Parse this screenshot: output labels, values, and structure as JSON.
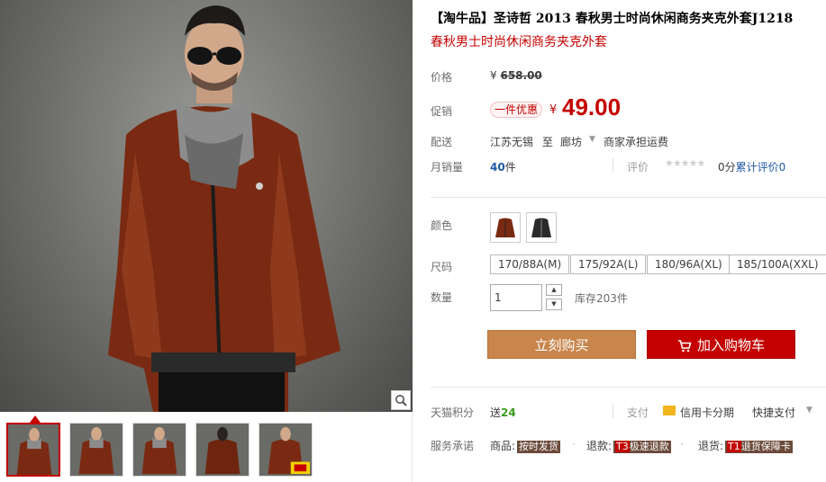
{
  "product": {
    "title": "【淘牛品】圣诗哲 2013 春秋男士时尚休闲商务夹克外套J1218",
    "subtitle": "春秋男士时尚休闲商务夹克外套"
  },
  "price": {
    "label": "价格",
    "currency": "¥",
    "original": "658.00"
  },
  "promo": {
    "label": "促销",
    "tag": "一件优惠",
    "currency": "¥",
    "price": "49.00"
  },
  "shipping": {
    "label": "配送",
    "from": "江苏无锡",
    "to_word": "至",
    "destination": "廊坊",
    "fee": "商家承担运费"
  },
  "sales": {
    "label": "月销量",
    "count": "40",
    "unit": "件",
    "review_label": "评价",
    "stars": "★★★★★",
    "review_score": "0分",
    "review_count_text": "累计评价",
    "review_count": "0"
  },
  "color": {
    "label": "颜色",
    "options": [
      "brown jacket",
      "black jacket"
    ]
  },
  "size": {
    "label": "尺码",
    "options": [
      "170/88A(M)",
      "175/92A(L)",
      "180/96A(XL)",
      "185/100A(XXL)"
    ]
  },
  "quantity": {
    "label": "数量",
    "value": "1",
    "stock": "库存203件"
  },
  "actions": {
    "buy_now": "立刻购买",
    "add_to_cart": "加入购物车"
  },
  "points": {
    "label": "天猫积分",
    "prefix": "送",
    "value": "24",
    "pay_label": "支付",
    "credit": "信用卡分期",
    "quick_pay": "快捷支付"
  },
  "promise": {
    "label": "服务承诺",
    "goods_label": "商品:",
    "goods_tag": "按时发货",
    "refund_label": "退款:",
    "refund_code": "T3",
    "refund_tag": "极速退款",
    "return_label": "退货:",
    "return_code": "T1",
    "return_tag": "退货保障卡"
  },
  "colors": {
    "accent": "#c40000",
    "buy_button": "#c8854c",
    "link_blue": "#1f5aa8",
    "points_green": "#3a9a1a"
  },
  "icons": [
    "zoom-icon",
    "cart-icon",
    "credit-card-icon",
    "chevron-down-icon",
    "star-icon"
  ]
}
